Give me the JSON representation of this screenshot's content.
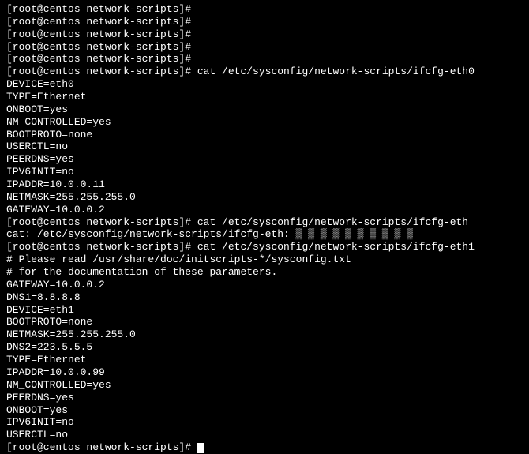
{
  "prompt_user": "root",
  "prompt_host": "centos",
  "prompt_cwd": "network-scripts",
  "prompt": "[root@centos network-scripts]#",
  "empty_count": 5,
  "cmd1": "cat /etc/sysconfig/network-scripts/ifcfg-eth0",
  "ifcfg_eth0": [
    "DEVICE=eth0",
    "TYPE=Ethernet",
    "ONBOOT=yes",
    "NM_CONTROLLED=yes",
    "BOOTPROTO=none",
    "USERCTL=no",
    "PEERDNS=yes",
    "IPV6INIT=no",
    "IPADDR=10.0.0.11",
    "NETMASK=255.255.255.0",
    "GATEWAY=10.0.0.2"
  ],
  "cmd2": "cat /etc/sysconfig/network-scripts/ifcfg-eth",
  "err": "cat: /etc/sysconfig/network-scripts/ifcfg-eth: ▒ ▒ ▒ ▒ ▒ ▒ ▒ ▒ ▒ ▒",
  "cmd3": "cat /etc/sysconfig/network-scripts/ifcfg-eth1",
  "ifcfg_eth1": [
    "# Please read /usr/share/doc/initscripts-*/sysconfig.txt",
    "# for the documentation of these parameters.",
    "GATEWAY=10.0.0.2",
    "DNS1=8.8.8.8",
    "DEVICE=eth1",
    "BOOTPROTO=none",
    "NETMASK=255.255.255.0",
    "DNS2=223.5.5.5",
    "TYPE=Ethernet",
    "IPADDR=10.0.0.99",
    "NM_CONTROLLED=yes",
    "PEERDNS=yes",
    "ONBOOT=yes",
    "IPV6INIT=no",
    "USERCTL=no"
  ]
}
